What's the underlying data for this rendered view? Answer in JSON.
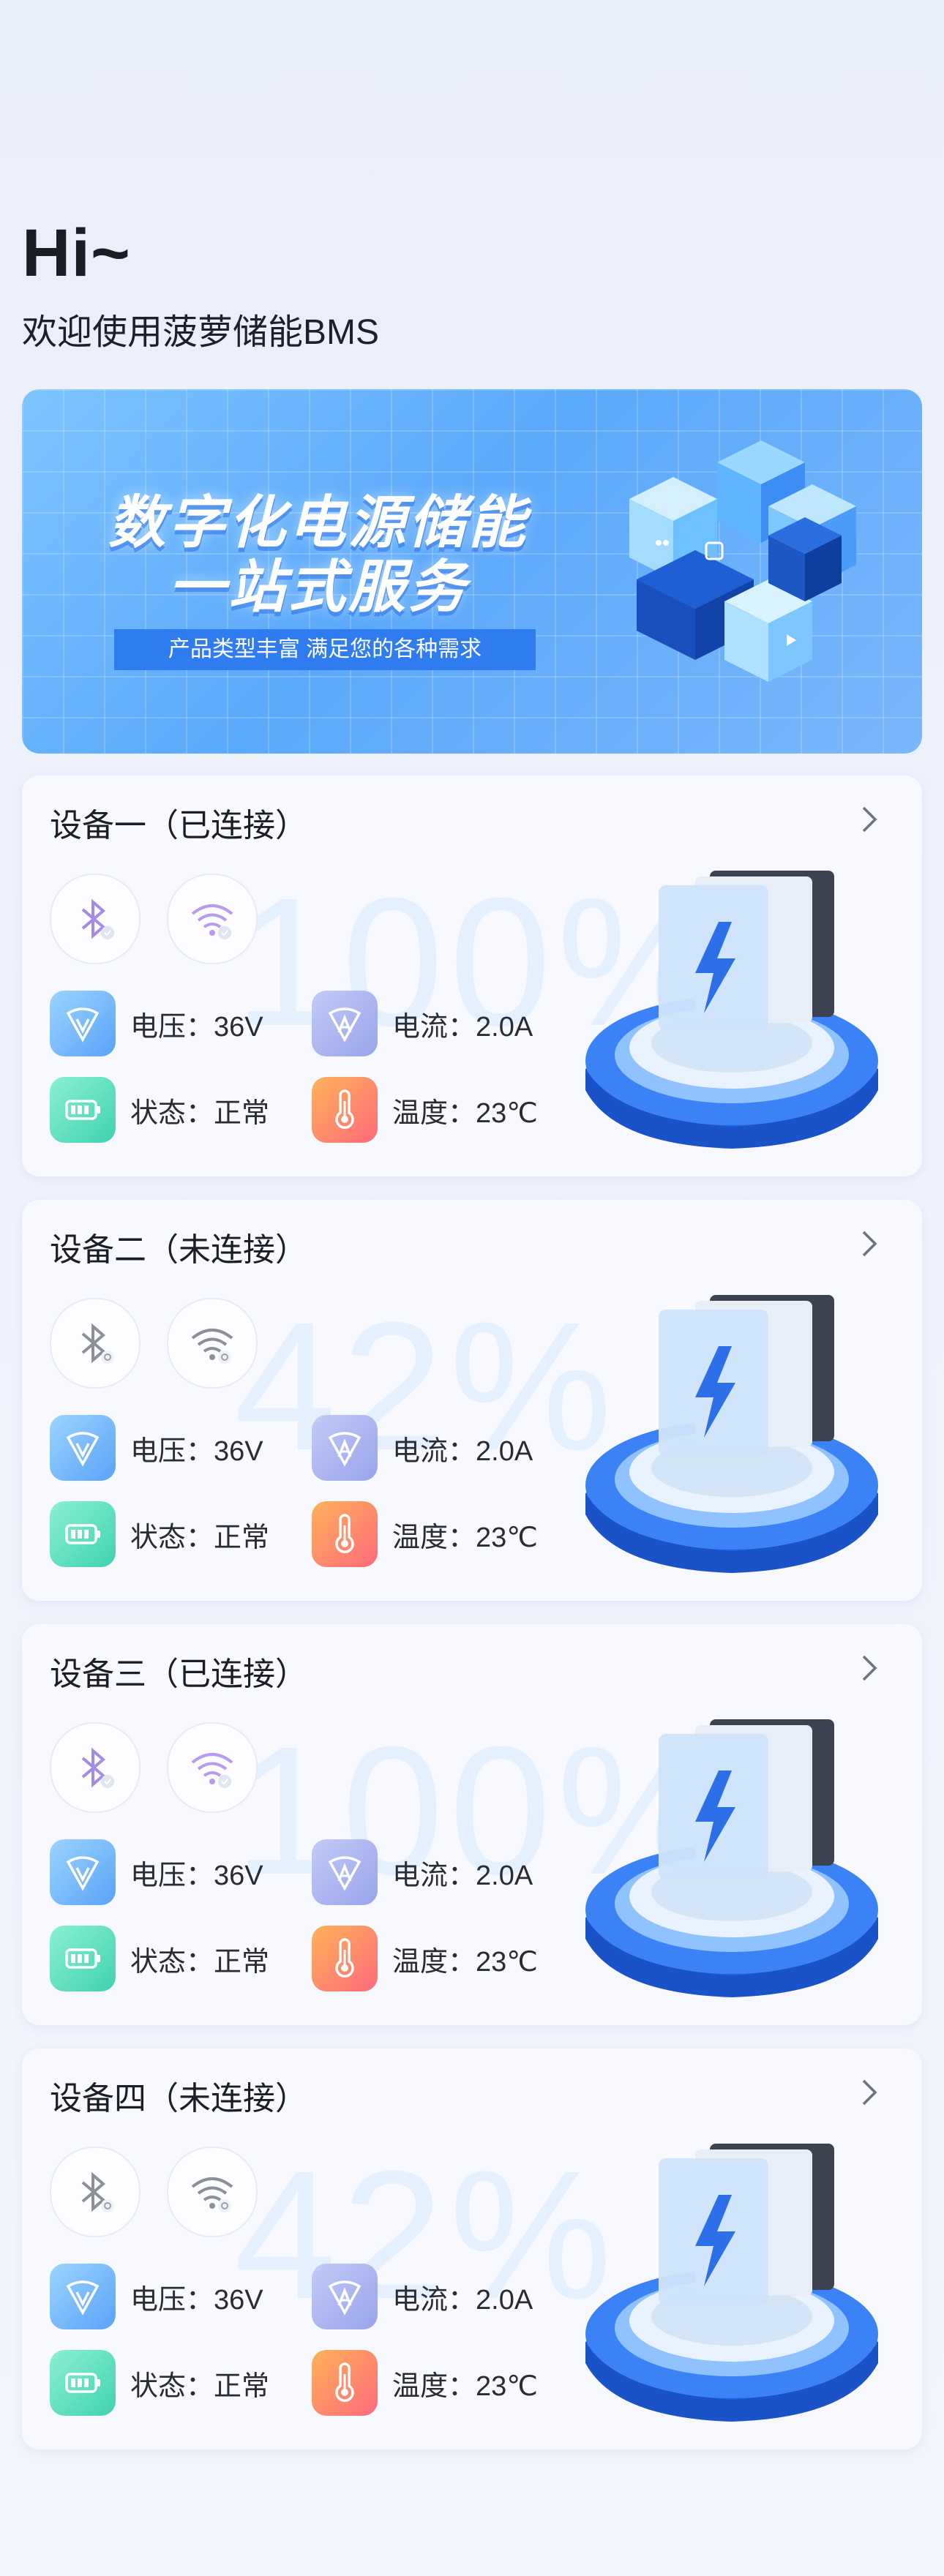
{
  "greeting": {
    "hi": "Hi~",
    "welcome": "欢迎使用菠萝储能BMS"
  },
  "banner": {
    "line1": "数字化电源储能",
    "line2": "一站式服务",
    "tagline": "产品类型丰富 满足您的各种需求"
  },
  "devices": [
    {
      "title": "设备一（已连接）",
      "percent": "100%",
      "connected": true,
      "voltage": "电压：36V",
      "current": "电流：2.0A",
      "status": "状态：正常",
      "temperature": "温度：23℃"
    },
    {
      "title": "设备二（未连接）",
      "percent": "42%",
      "connected": false,
      "voltage": "电压：36V",
      "current": "电流：2.0A",
      "status": "状态：正常",
      "temperature": "温度：23℃"
    },
    {
      "title": "设备三（已连接）",
      "percent": "100%",
      "connected": true,
      "voltage": "电压：36V",
      "current": "电流：2.0A",
      "status": "状态：正常",
      "temperature": "温度：23℃"
    },
    {
      "title": "设备四（未连接）",
      "percent": "42%",
      "connected": false,
      "voltage": "电压：36V",
      "current": "电流：2.0A",
      "status": "状态：正常",
      "temperature": "温度：23℃"
    }
  ],
  "colors": {
    "accent": "#3b86f5",
    "connected_icon": "#a58be8",
    "disconnected_icon": "#8b8f99"
  },
  "icons": {
    "bluetooth": "bluetooth-icon",
    "wifi": "wifi-icon",
    "voltage": "voltage-icon",
    "current": "current-icon",
    "battery": "battery-icon",
    "temperature": "thermometer-icon",
    "chevron": "chevron-right-icon"
  }
}
